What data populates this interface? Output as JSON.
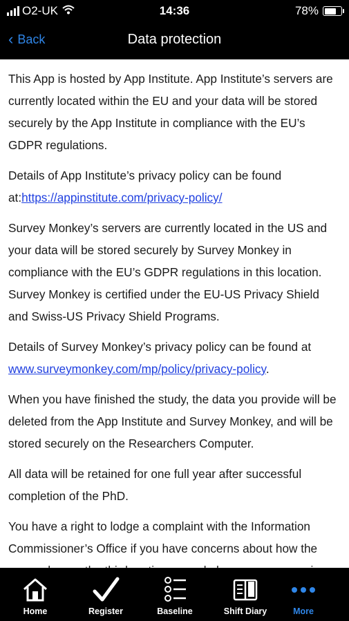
{
  "status_bar": {
    "carrier": "O2-UK",
    "time": "14:36",
    "battery": "78%",
    "battery_level": 0.78
  },
  "nav": {
    "back_label": "Back",
    "title": "Data protection"
  },
  "content": {
    "p1": "This App is hosted by App Institute. App Institute’s servers are currently located within the EU and your data will be stored securely by the App Institute in compliance with the EU’s GDPR regulations.",
    "p2_text": "Details of App Institute’s privacy policy can be found at:",
    "p2_link": "https://appinstitute.com/privacy-policy/",
    "p3": "Survey Monkey’s servers are currently located in the US and your data will be stored securely by Survey Monkey in compliance with the EU’s GDPR regulations in this location. Survey Monkey is certified under the EU-US Privacy Shield and Swiss-US Privacy Shield Programs.",
    "p4_text": "Details of Survey Monkey’s privacy policy can be found at ",
    "p4_link": "www.surveymonkey.com/mp/policy/privacy-policy",
    "p4_end": ".",
    "p5": "When you have finished the study, the data you provide will be deleted from the App Institute and Survey Monkey, and will be stored securely on the Researchers Computer.",
    "p6": "All data will be retained for one full year after successful completion of the PhD.",
    "p7": "You have a right to lodge a complaint with the Information Commissioner’s Office if you have concerns about how the researcher, or the third parties named above, are processing"
  },
  "tabs": [
    {
      "label": "Home",
      "icon": "home-icon"
    },
    {
      "label": "Register",
      "icon": "checkmark-icon"
    },
    {
      "label": "Baseline",
      "icon": "list-icon"
    },
    {
      "label": "Shift Diary",
      "icon": "book-icon"
    },
    {
      "label": "More",
      "icon": "more-dots-icon",
      "active": true
    }
  ],
  "colors": {
    "accent": "#2f86e8",
    "link": "#2040e0",
    "bar_background": "#000000"
  }
}
